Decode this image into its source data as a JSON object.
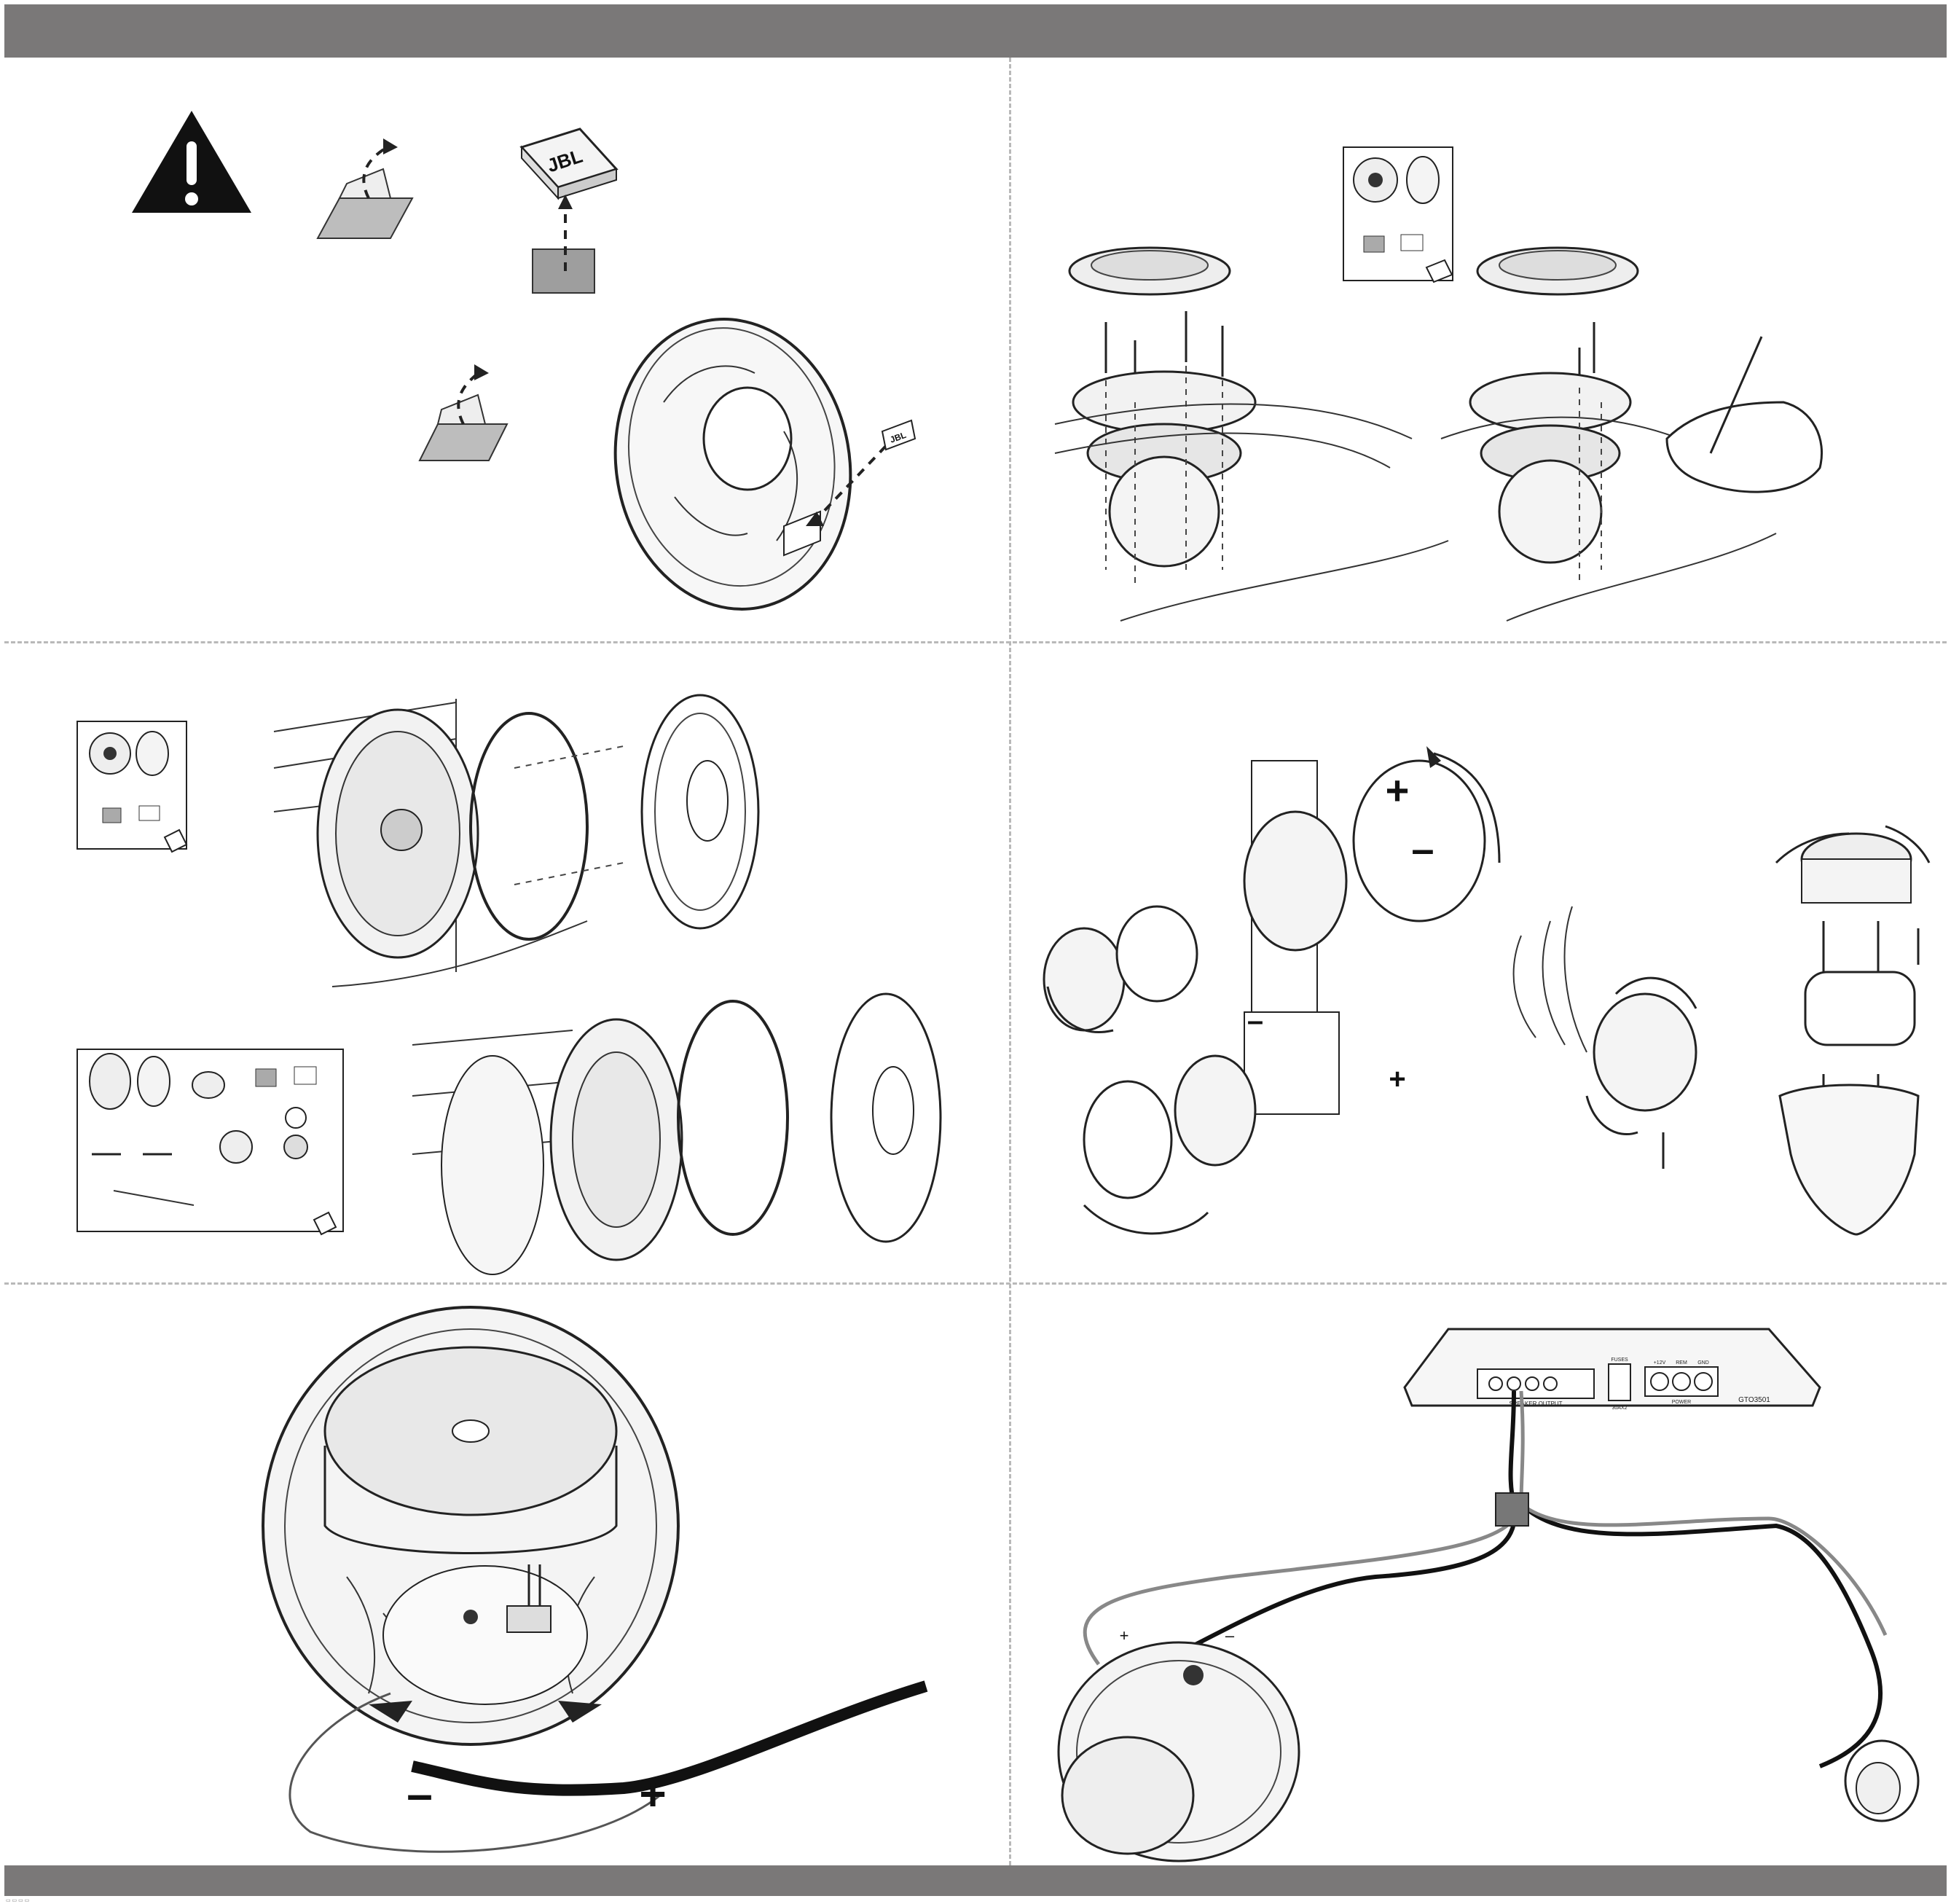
{
  "document": {
    "header_bar_color": "#7a7878",
    "footer_bar_color": "#7a7878",
    "divider_color": "#b9b9b9"
  },
  "panels": [
    {
      "id": "badge-application",
      "icons": [
        "warning-triangle-icon",
        "peel-backing-icon",
        "jbl-badge-icon",
        "grille-icon"
      ]
    },
    {
      "id": "surface-mount",
      "icons": [
        "grille-ring-icon",
        "screws-icon",
        "speaker-icon",
        "parts-box-icon",
        "hand-icon"
      ]
    },
    {
      "id": "door-mount",
      "icons": [
        "parts-box-icon",
        "coaxial-speaker-icon",
        "grille-icon",
        "component-kit-icon"
      ]
    },
    {
      "id": "tweeter-mount",
      "icons": [
        "tweeter-flush-mount-icon",
        "tweeter-swivel-icon",
        "pod-mount-icon"
      ]
    },
    {
      "id": "woofer-wiring",
      "icons": [
        "woofer-rear-icon",
        "terminal-icon"
      ]
    },
    {
      "id": "amplifier-wiring",
      "icons": [
        "amplifier-icon",
        "woofer-icon",
        "tweeter-icon"
      ]
    }
  ],
  "labels": {
    "badge": "JBL",
    "plus": "+",
    "minus": "–",
    "amp_output": "SPEAKER OUTPUT",
    "amp_fuses": "FUSES",
    "amp_fuse_rating": "30AX2",
    "amp_power_plus": "+12V",
    "amp_power_rem": "REM",
    "amp_power_gnd": "GND",
    "amp_power": "POWER",
    "amp_model": "GTO3501",
    "footer_mark": "▭ ▭ ▭ ▭"
  }
}
